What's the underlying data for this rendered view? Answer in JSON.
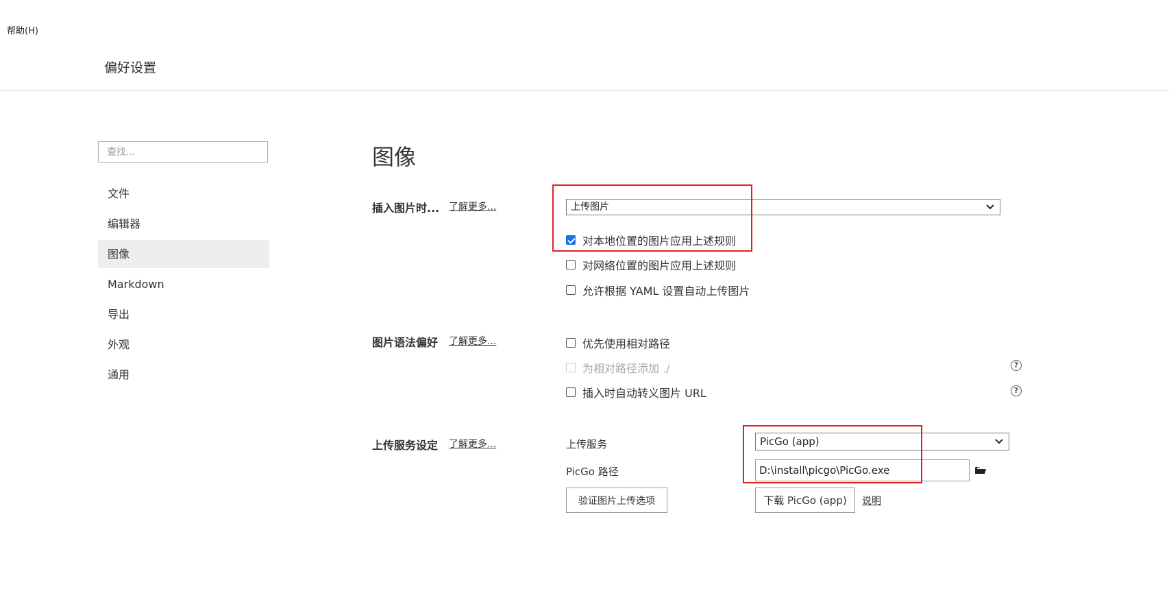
{
  "menu": {
    "help": "帮助(H)"
  },
  "window": {
    "title": "偏好设置"
  },
  "sidebar": {
    "search_placeholder": "查找...",
    "items": [
      {
        "label": "文件"
      },
      {
        "label": "编辑器"
      },
      {
        "label": "图像"
      },
      {
        "label": "Markdown"
      },
      {
        "label": "导出"
      },
      {
        "label": "外观"
      },
      {
        "label": "通用"
      }
    ]
  },
  "main": {
    "heading": "图像",
    "insert": {
      "label": "插入图片时...",
      "learn_more": "了解更多...",
      "select_value": "上传图片",
      "options": [
        {
          "label": "对本地位置的图片应用上述规则",
          "checked": true
        },
        {
          "label": "对网络位置的图片应用上述规则",
          "checked": false
        },
        {
          "label": "允许根据 YAML 设置自动上传图片",
          "checked": false
        }
      ]
    },
    "syntax": {
      "label": "图片语法偏好",
      "learn_more": "了解更多...",
      "options": [
        {
          "label": "优先使用相对路径",
          "checked": false
        },
        {
          "label": "为相对路径添加 ./",
          "checked": false,
          "disabled": true
        },
        {
          "label": "插入时自动转义图片 URL",
          "checked": false
        }
      ]
    },
    "upload": {
      "label": "上传服务设定",
      "learn_more": "了解更多...",
      "service_label": "上传服务",
      "service_value": "PicGo (app)",
      "path_label": "PicGo 路径",
      "path_value": "D:\\install\\picgo\\PicGo.exe",
      "verify_button": "验证图片上传选项",
      "download_button": "下载 PicGo (app)",
      "explain_link": "说明"
    }
  },
  "colors": {
    "highlight_box": "#e02020",
    "checkbox_checked": "#1a73e8"
  }
}
